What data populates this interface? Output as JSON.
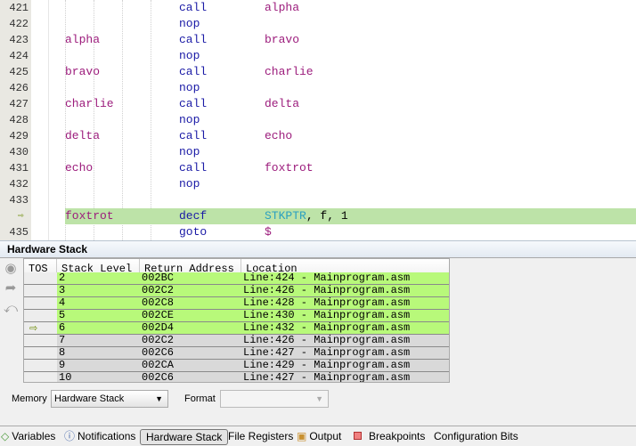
{
  "editor": {
    "lines": [
      {
        "num": "421",
        "label": "",
        "instr": "call",
        "operand": "alpha"
      },
      {
        "num": "422",
        "label": "",
        "instr": "nop",
        "operand": ""
      },
      {
        "num": "423",
        "label": "alpha",
        "instr": "call",
        "operand": "bravo"
      },
      {
        "num": "424",
        "label": "",
        "instr": "nop",
        "operand": ""
      },
      {
        "num": "425",
        "label": "bravo",
        "instr": "call",
        "operand": "charlie"
      },
      {
        "num": "426",
        "label": "",
        "instr": "nop",
        "operand": ""
      },
      {
        "num": "427",
        "label": "charlie",
        "instr": "call",
        "operand": "delta"
      },
      {
        "num": "428",
        "label": "",
        "instr": "nop",
        "operand": ""
      },
      {
        "num": "429",
        "label": "delta",
        "instr": "call",
        "operand": "echo"
      },
      {
        "num": "430",
        "label": "",
        "instr": "nop",
        "operand": ""
      },
      {
        "num": "431",
        "label": "echo",
        "instr": "call",
        "operand": "foxtrot"
      },
      {
        "num": "432",
        "label": "",
        "instr": "nop",
        "operand": ""
      },
      {
        "num": "433",
        "label": "",
        "instr": "",
        "operand": ""
      },
      {
        "num": "",
        "label": "foxtrot",
        "instr": "decf",
        "operand_reg": "STKPTR",
        "operand_rest": ", f, 1",
        "current": true
      },
      {
        "num": "435",
        "label": "",
        "instr": "goto",
        "operand": "$"
      }
    ]
  },
  "panel": {
    "title": "Hardware Stack"
  },
  "table": {
    "columns": [
      "TOS",
      "Stack Level",
      "Return Address",
      "Location"
    ],
    "rows": [
      {
        "level": "2",
        "addr": "002BC",
        "loc": "Line:424 - Mainprogram.asm",
        "active": true
      },
      {
        "level": "3",
        "addr": "002C2",
        "loc": "Line:426 - Mainprogram.asm",
        "active": true
      },
      {
        "level": "4",
        "addr": "002C8",
        "loc": "Line:428 - Mainprogram.asm",
        "active": true
      },
      {
        "level": "5",
        "addr": "002CE",
        "loc": "Line:430 - Mainprogram.asm",
        "active": true
      },
      {
        "level": "6",
        "addr": "002D4",
        "loc": "Line:432 - Mainprogram.asm",
        "active": true,
        "tos": true
      },
      {
        "level": "7",
        "addr": "002C2",
        "loc": "Line:426 - Mainprogram.asm",
        "active": false
      },
      {
        "level": "8",
        "addr": "002C6",
        "loc": "Line:427 - Mainprogram.asm",
        "active": false
      },
      {
        "level": "9",
        "addr": "002CA",
        "loc": "Line:429 - Mainprogram.asm",
        "active": false
      },
      {
        "level": "10",
        "addr": "002C6",
        "loc": "Line:427 - Mainprogram.asm",
        "active": false
      }
    ]
  },
  "controls": {
    "memory_label": "Memory",
    "memory_value": "Hardware Stack",
    "format_label": "Format",
    "format_value": ""
  },
  "tabs": [
    {
      "label": "Variables",
      "icon": "diamond-icon"
    },
    {
      "label": "Notifications",
      "icon": "info-icon"
    },
    {
      "label": "Hardware Stack",
      "active": true
    },
    {
      "label": "File Registers"
    },
    {
      "label": "Output",
      "icon": "output-icon"
    },
    {
      "label": "Breakpoints",
      "icon": "breakpoint-icon"
    },
    {
      "label": "Configuration Bits"
    }
  ],
  "colors": {
    "active_row": "#b8f97a",
    "inactive_row": "#d9d9d9",
    "current_line": "#bde3a8"
  }
}
